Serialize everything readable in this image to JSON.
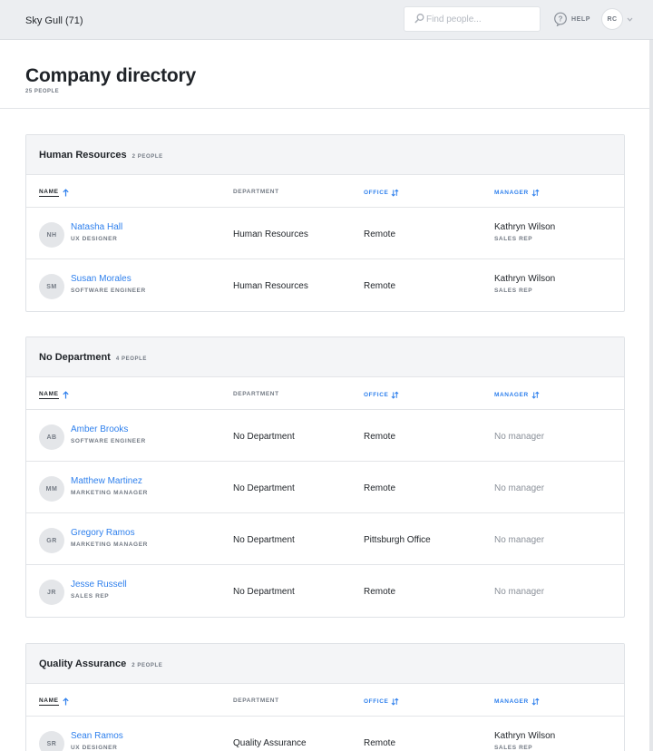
{
  "topbar": {
    "company": "Sky Gull (71)",
    "search_placeholder": "Find people...",
    "help_label": "HELP",
    "user_initials": "RC"
  },
  "page": {
    "title": "Company directory",
    "count": "25 PEOPLE"
  },
  "columns": {
    "name": "NAME",
    "department": "DEPARTMENT",
    "office": "OFFICE",
    "manager": "MANAGER"
  },
  "groups": [
    {
      "name": "Human Resources",
      "count": "2 PEOPLE",
      "people": [
        {
          "initials": "NH",
          "name": "Natasha Hall",
          "title": "UX DESIGNER",
          "department": "Human Resources",
          "office": "Remote",
          "manager": "Kathryn Wilson",
          "manager_title": "SALES REP"
        },
        {
          "initials": "SM",
          "name": "Susan Morales",
          "title": "SOFTWARE ENGINEER",
          "department": "Human Resources",
          "office": "Remote",
          "manager": "Kathryn Wilson",
          "manager_title": "SALES REP"
        }
      ]
    },
    {
      "name": "No Department",
      "count": "4 PEOPLE",
      "people": [
        {
          "initials": "AB",
          "name": "Amber Brooks",
          "title": "SOFTWARE ENGINEER",
          "department": "No Department",
          "office": "Remote",
          "manager": "No manager",
          "manager_title": ""
        },
        {
          "initials": "MM",
          "name": "Matthew Martinez",
          "title": "MARKETING MANAGER",
          "department": "No Department",
          "office": "Remote",
          "manager": "No manager",
          "manager_title": ""
        },
        {
          "initials": "GR",
          "name": "Gregory Ramos",
          "title": "MARKETING MANAGER",
          "department": "No Department",
          "office": "Pittsburgh Office",
          "manager": "No manager",
          "manager_title": ""
        },
        {
          "initials": "JR",
          "name": "Jesse Russell",
          "title": "SALES REP",
          "department": "No Department",
          "office": "Remote",
          "manager": "No manager",
          "manager_title": ""
        }
      ]
    },
    {
      "name": "Quality Assurance",
      "count": "2 PEOPLE",
      "people": [
        {
          "initials": "SR",
          "name": "Sean Ramos",
          "title": "UX DESIGNER",
          "department": "Quality Assurance",
          "office": "Remote",
          "manager": "Kathryn Wilson",
          "manager_title": "SALES REP"
        }
      ]
    }
  ],
  "colors": {
    "accent": "#2f80ed",
    "topbar_bg": "#eceef1",
    "group_header_bg": "#f4f5f7",
    "muted_text": "#737a84"
  },
  "icons": {
    "search": "search-icon",
    "help": "help-icon",
    "sort_asc": "arrow-up-icon",
    "sort_both": "sort-arrows-icon",
    "menu": "chevron-down-icon"
  }
}
